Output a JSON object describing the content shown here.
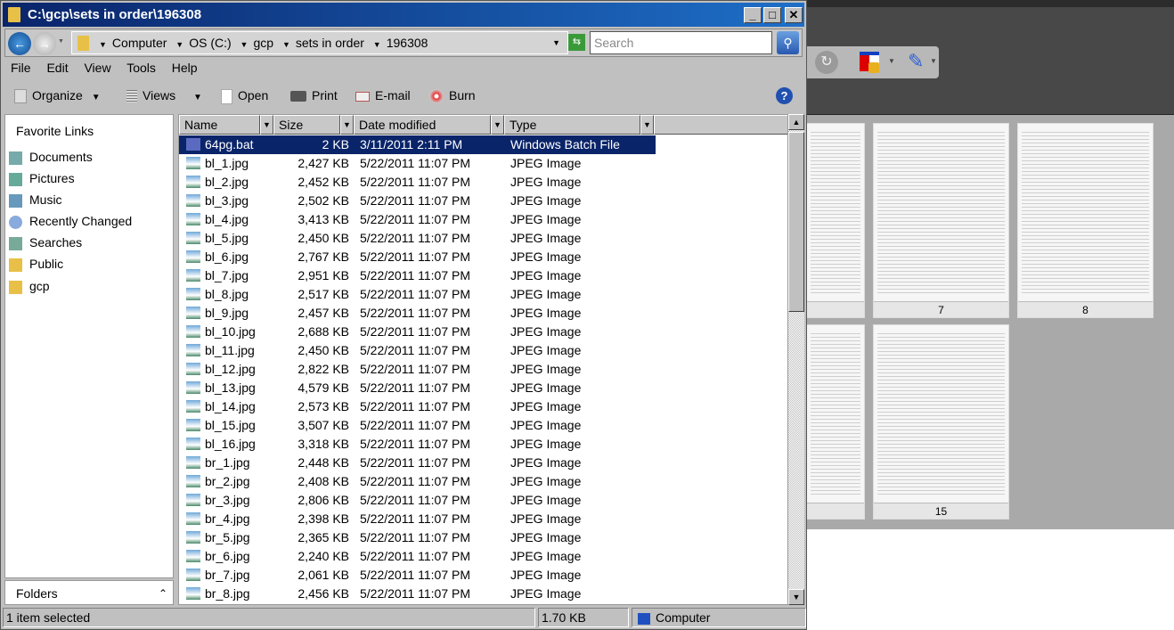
{
  "window": {
    "title": "C:\\gcp\\sets in order\\196308"
  },
  "address": {
    "crumbs": [
      "Computer",
      "OS (C:)",
      "gcp",
      "sets in order",
      "196308"
    ],
    "search_placeholder": "Search"
  },
  "menu": [
    "File",
    "Edit",
    "View",
    "Tools",
    "Help"
  ],
  "toolbar": {
    "organize": "Organize",
    "views": "Views",
    "open": "Open",
    "print": "Print",
    "email": "E-mail",
    "burn": "Burn"
  },
  "nav": {
    "heading": "Favorite Links",
    "items": [
      {
        "label": "Documents",
        "icon": "documents-icon"
      },
      {
        "label": "Pictures",
        "icon": "pictures-icon"
      },
      {
        "label": "Music",
        "icon": "music-icon"
      },
      {
        "label": "Recently Changed",
        "icon": "recent-icon"
      },
      {
        "label": "Searches",
        "icon": "searches-icon"
      },
      {
        "label": "Public",
        "icon": "folder-icon"
      },
      {
        "label": "gcp",
        "icon": "folder-icon"
      }
    ],
    "folders": "Folders"
  },
  "columns": [
    "Name",
    "Size",
    "Date modified",
    "Type"
  ],
  "files": [
    {
      "name": "64pg.bat",
      "size": "2 KB",
      "date": "3/11/2011 2:11 PM",
      "type": "Windows Batch File",
      "selected": true
    },
    {
      "name": "bl_1.jpg",
      "size": "2,427 KB",
      "date": "5/22/2011 11:07 PM",
      "type": "JPEG Image"
    },
    {
      "name": "bl_2.jpg",
      "size": "2,452 KB",
      "date": "5/22/2011 11:07 PM",
      "type": "JPEG Image"
    },
    {
      "name": "bl_3.jpg",
      "size": "2,502 KB",
      "date": "5/22/2011 11:07 PM",
      "type": "JPEG Image"
    },
    {
      "name": "bl_4.jpg",
      "size": "3,413 KB",
      "date": "5/22/2011 11:07 PM",
      "type": "JPEG Image"
    },
    {
      "name": "bl_5.jpg",
      "size": "2,450 KB",
      "date": "5/22/2011 11:07 PM",
      "type": "JPEG Image"
    },
    {
      "name": "bl_6.jpg",
      "size": "2,767 KB",
      "date": "5/22/2011 11:07 PM",
      "type": "JPEG Image"
    },
    {
      "name": "bl_7.jpg",
      "size": "2,951 KB",
      "date": "5/22/2011 11:07 PM",
      "type": "JPEG Image"
    },
    {
      "name": "bl_8.jpg",
      "size": "2,517 KB",
      "date": "5/22/2011 11:07 PM",
      "type": "JPEG Image"
    },
    {
      "name": "bl_9.jpg",
      "size": "2,457 KB",
      "date": "5/22/2011 11:07 PM",
      "type": "JPEG Image"
    },
    {
      "name": "bl_10.jpg",
      "size": "2,688 KB",
      "date": "5/22/2011 11:07 PM",
      "type": "JPEG Image"
    },
    {
      "name": "bl_11.jpg",
      "size": "2,450 KB",
      "date": "5/22/2011 11:07 PM",
      "type": "JPEG Image"
    },
    {
      "name": "bl_12.jpg",
      "size": "2,822 KB",
      "date": "5/22/2011 11:07 PM",
      "type": "JPEG Image"
    },
    {
      "name": "bl_13.jpg",
      "size": "4,579 KB",
      "date": "5/22/2011 11:07 PM",
      "type": "JPEG Image"
    },
    {
      "name": "bl_14.jpg",
      "size": "2,573 KB",
      "date": "5/22/2011 11:07 PM",
      "type": "JPEG Image"
    },
    {
      "name": "bl_15.jpg",
      "size": "3,507 KB",
      "date": "5/22/2011 11:07 PM",
      "type": "JPEG Image"
    },
    {
      "name": "bl_16.jpg",
      "size": "3,318 KB",
      "date": "5/22/2011 11:07 PM",
      "type": "JPEG Image"
    },
    {
      "name": "br_1.jpg",
      "size": "2,448 KB",
      "date": "5/22/2011 11:07 PM",
      "type": "JPEG Image"
    },
    {
      "name": "br_2.jpg",
      "size": "2,408 KB",
      "date": "5/22/2011 11:07 PM",
      "type": "JPEG Image"
    },
    {
      "name": "br_3.jpg",
      "size": "2,806 KB",
      "date": "5/22/2011 11:07 PM",
      "type": "JPEG Image"
    },
    {
      "name": "br_4.jpg",
      "size": "2,398 KB",
      "date": "5/22/2011 11:07 PM",
      "type": "JPEG Image"
    },
    {
      "name": "br_5.jpg",
      "size": "2,365 KB",
      "date": "5/22/2011 11:07 PM",
      "type": "JPEG Image"
    },
    {
      "name": "br_6.jpg",
      "size": "2,240 KB",
      "date": "5/22/2011 11:07 PM",
      "type": "JPEG Image"
    },
    {
      "name": "br_7.jpg",
      "size": "2,061 KB",
      "date": "5/22/2011 11:07 PM",
      "type": "JPEG Image"
    },
    {
      "name": "br_8.jpg",
      "size": "2,456 KB",
      "date": "5/22/2011 11:07 PM",
      "type": "JPEG Image"
    }
  ],
  "status": {
    "selection": "1 item selected",
    "size": "1.70 KB",
    "zone": "Computer"
  },
  "viewer": {
    "pages": [
      "",
      "7",
      "8",
      "",
      "15"
    ]
  }
}
